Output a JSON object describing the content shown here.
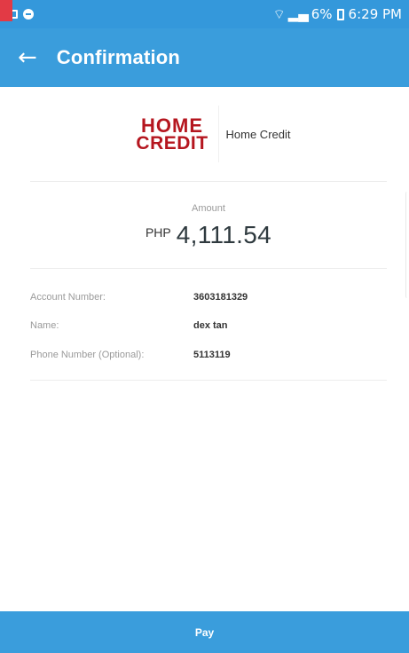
{
  "status_bar": {
    "signal_text": "",
    "battery_percent": "6%",
    "time": "6:29 PM"
  },
  "app_bar": {
    "title": "Confirmation",
    "back_icon": "arrow-left-icon"
  },
  "merchant": {
    "logo_line1": "HOME",
    "logo_line2": "CREDIT",
    "name": "Home Credit"
  },
  "amount": {
    "label": "Amount",
    "currency": "PHP",
    "value": "4,111.54"
  },
  "details": [
    {
      "label": "Account Number:",
      "value": "3603181329"
    },
    {
      "label": "Name:",
      "value": "dex tan"
    },
    {
      "label": "Phone Number (Optional):",
      "value": "5113119"
    }
  ],
  "pay_button": {
    "label": "Pay"
  },
  "colors": {
    "primary": "#3a9ddc",
    "status_bar": "#3498db",
    "brand_red": "#b5161f"
  }
}
